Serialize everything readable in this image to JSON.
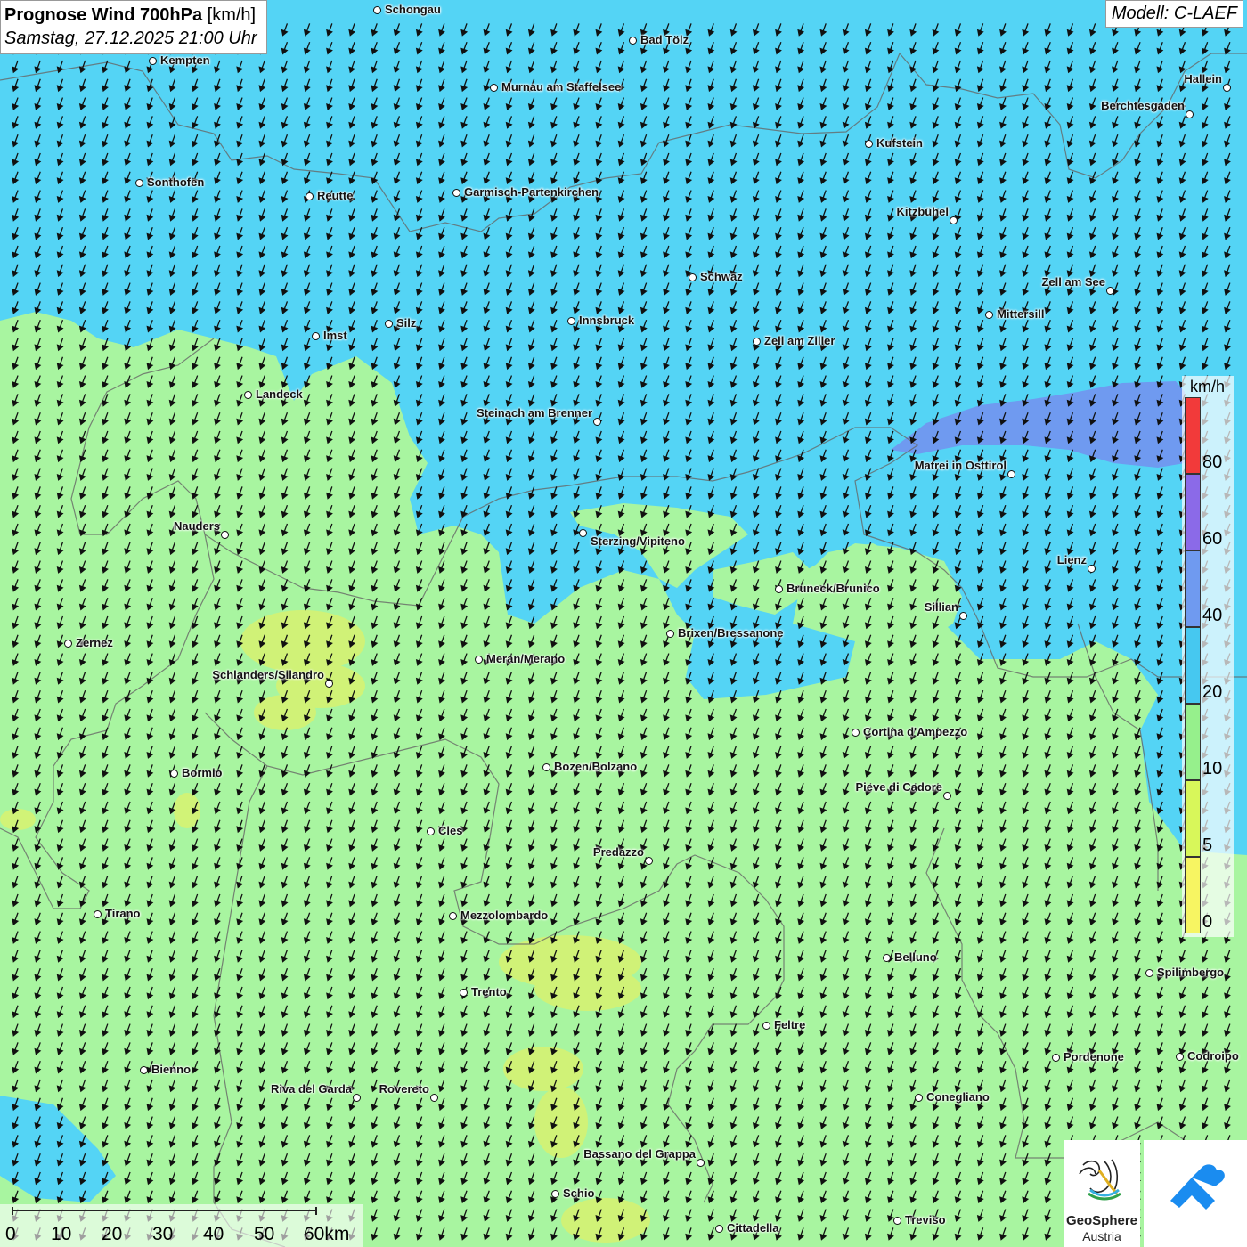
{
  "map": {
    "title_bold": "Prognose Wind 700hPa",
    "title_unit": "[km/h]",
    "datetime": "Samstag, 27.12.2025 21:00 Uhr",
    "model": "Modell: C-LAEF",
    "wind_direction": "from north-northeast (arrows pointing south-southwest)",
    "colors": {
      "0-5": "#f5f55a",
      "5-10": "#c4f27a",
      "10-20": "#a8f5a0",
      "20-40": "#54d4f5",
      "40-60": "#6f9af0",
      "60-80": "#8b6ae8",
      "80+": "#f23a3a"
    }
  },
  "legend": {
    "unit": "km/h",
    "ticks": [
      "80",
      "60",
      "40",
      "20",
      "10",
      "5",
      "0"
    ],
    "bands": [
      {
        "color": "#f23a3a"
      },
      {
        "color": "#8b6ae8"
      },
      {
        "color": "#6f9af0"
      },
      {
        "color": "#46c8f0"
      },
      {
        "color": "#96f08c"
      },
      {
        "color": "#d8f75a"
      },
      {
        "color": "#f7f562"
      }
    ]
  },
  "scale": {
    "labels": [
      "0",
      "10",
      "20",
      "30",
      "40",
      "50",
      "60km"
    ]
  },
  "logo": {
    "name_line1": "GeoSphere",
    "name_line2": "Austria"
  },
  "cities": [
    {
      "name": "Schongau",
      "label_side": "right"
    },
    {
      "name": "Bad Tölz",
      "label_side": "right"
    },
    {
      "name": "Kempten",
      "label_side": "right"
    },
    {
      "name": "Murnau am Staffelsee",
      "label_side": "right"
    },
    {
      "name": "Hallein",
      "label_side": "left"
    },
    {
      "name": "Berchtesgaden",
      "label_side": "left"
    },
    {
      "name": "Kufstein",
      "label_side": "right"
    },
    {
      "name": "Sonthofen",
      "label_side": "right"
    },
    {
      "name": "Reutte",
      "label_side": "right"
    },
    {
      "name": "Garmisch-Partenkirchen",
      "label_side": "right"
    },
    {
      "name": "Kitzbühel",
      "label_side": "left"
    },
    {
      "name": "Schwaz",
      "label_side": "right"
    },
    {
      "name": "Zell am See",
      "label_side": "left"
    },
    {
      "name": "Mittersill",
      "label_side": "right"
    },
    {
      "name": "Innsbruck",
      "label_side": "right"
    },
    {
      "name": "Silz",
      "label_side": "right"
    },
    {
      "name": "Imst",
      "label_side": "right"
    },
    {
      "name": "Zell am Ziller",
      "label_side": "right"
    },
    {
      "name": "Landeck",
      "label_side": "right"
    },
    {
      "name": "Steinach am Brenner",
      "label_side": "left"
    },
    {
      "name": "Matrei in Osttirol",
      "label_side": "left"
    },
    {
      "name": "Nauders",
      "label_side": "left"
    },
    {
      "name": "Sterzing/Vipiteno",
      "label_side": "below"
    },
    {
      "name": "Lienz",
      "label_side": "left"
    },
    {
      "name": "Bruneck/Brunico",
      "label_side": "right"
    },
    {
      "name": "Sillian",
      "label_side": "left"
    },
    {
      "name": "Zernez",
      "label_side": "right"
    },
    {
      "name": "Brixen/Bressanone",
      "label_side": "right"
    },
    {
      "name": "Meran/Merano",
      "label_side": "right"
    },
    {
      "name": "Schlanders/Silandro",
      "label_side": "left"
    },
    {
      "name": "Cortina d'Ampezzo",
      "label_side": "right"
    },
    {
      "name": "Bozen/Bolzano",
      "label_side": "right"
    },
    {
      "name": "Bormio",
      "label_side": "right"
    },
    {
      "name": "Pieve di Cadore",
      "label_side": "left"
    },
    {
      "name": "Cles",
      "label_side": "right"
    },
    {
      "name": "Predazzo",
      "label_side": "left"
    },
    {
      "name": "Tirano",
      "label_side": "right"
    },
    {
      "name": "Mezzolombardo",
      "label_side": "right"
    },
    {
      "name": "Belluno",
      "label_side": "right"
    },
    {
      "name": "Spilimbergo",
      "label_side": "right"
    },
    {
      "name": "Trento",
      "label_side": "right"
    },
    {
      "name": "Feltre",
      "label_side": "right"
    },
    {
      "name": "Pordenone",
      "label_side": "right"
    },
    {
      "name": "Codroipo",
      "label_side": "right"
    },
    {
      "name": "Bienno",
      "label_side": "right"
    },
    {
      "name": "Riva del Garda",
      "label_side": "left"
    },
    {
      "name": "Rovereto",
      "label_side": "left"
    },
    {
      "name": "Conegliano",
      "label_side": "right"
    },
    {
      "name": "Bassano del Grappa",
      "label_side": "left"
    },
    {
      "name": "Schio",
      "label_side": "right"
    },
    {
      "name": "Treviso",
      "label_side": "right"
    },
    {
      "name": "Cittadella",
      "label_side": "right"
    }
  ]
}
